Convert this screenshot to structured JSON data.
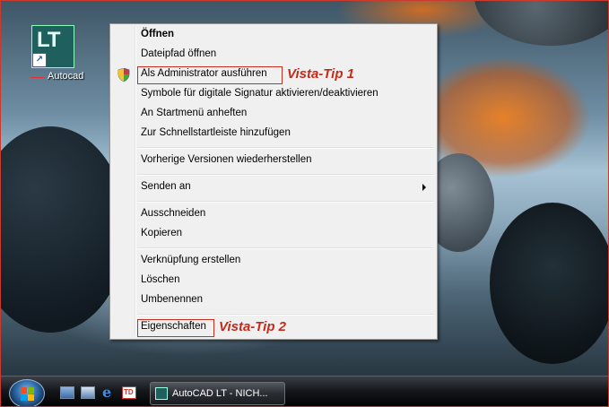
{
  "desktop": {
    "icon_text": "LT",
    "icon_label": "Autocad"
  },
  "context_menu": {
    "items": [
      {
        "label": "Öffnen"
      },
      {
        "label": "Dateipfad öffnen"
      },
      {
        "label": "Als Administrator ausführen"
      },
      {
        "label": "Symbole für digitale Signatur aktivieren/deaktivieren"
      },
      {
        "label": "An Startmenü anheften"
      },
      {
        "label": "Zur Schnellstartleiste hinzufügen"
      },
      {
        "label": "Vorherige Versionen wiederherstellen"
      },
      {
        "label": "Senden an"
      },
      {
        "label": "Ausschneiden"
      },
      {
        "label": "Kopieren"
      },
      {
        "label": "Verknüpfung erstellen"
      },
      {
        "label": "Löschen"
      },
      {
        "label": "Umbenennen"
      },
      {
        "label": "Eigenschaften"
      }
    ]
  },
  "annotations": {
    "tip1": "Vista-Tip 1",
    "tip2": "Vista-Tip 2"
  },
  "taskbar": {
    "window_button_label": "AutoCAD LT - NICH...",
    "icons": [
      "start-orb-icon",
      "show-desktop-icon",
      "switch-windows-icon",
      "internet-explorer-icon",
      "td-app-icon",
      "autocad-app-icon"
    ]
  },
  "colors": {
    "annotation_red": "#c82a1a",
    "menu_background": "#f0f0f0"
  }
}
